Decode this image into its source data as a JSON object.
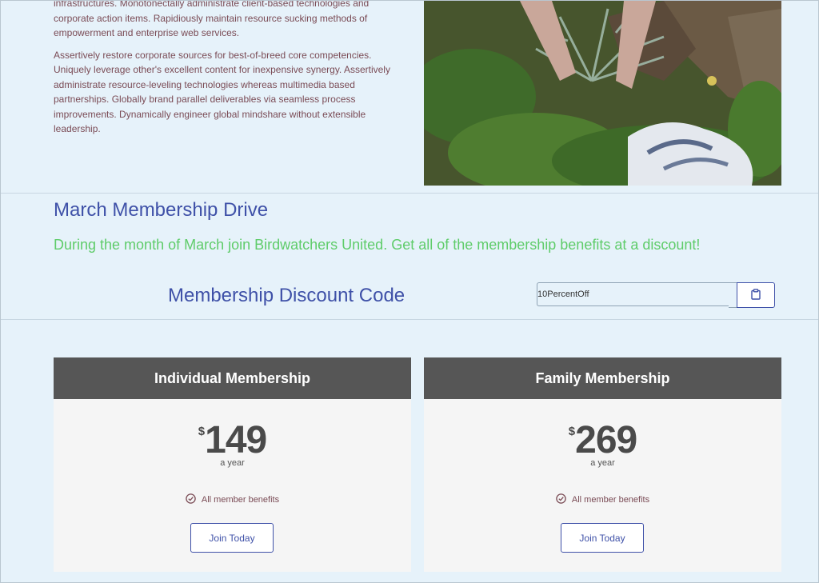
{
  "intro": {
    "paragraph_1": "infrastructures. Monotonectally administrate client-based technologies and corporate action items. Rapidiously maintain resource sucking methods of empowerment and enterprise web services.",
    "paragraph_2": "Assertively restore corporate sources for best-of-breed core competencies. Uniquely leverage other's excellent content for inexpensive synergy. Assertively administrate resource-leveling technologies whereas multimedia based partnerships. Globally brand parallel deliverables via seamless process improvements. Dynamically engineer global mindshare without extensible leadership."
  },
  "drive": {
    "title": "March Membership Drive",
    "subtitle": "During the month of March join Birdwatchers United.  Get all of the membership benefits at a discount!",
    "code_label": "Membership Discount Code",
    "code_value": "10PercentOff",
    "copy_icon": "clipboard-icon"
  },
  "plans": [
    {
      "name": "Individual Membership",
      "currency": "$",
      "price": "149",
      "period": "a year",
      "benefit": "All member benefits",
      "button": "Join Today"
    },
    {
      "name": "Family Membership",
      "currency": "$",
      "price": "269",
      "period": "a year",
      "benefit": "All member benefits",
      "button": "Join Today"
    }
  ],
  "colors": {
    "background": "#e6f2fa",
    "heading_blue": "#3f51a8",
    "accent_green": "#5fcc6a",
    "body_text": "#7a4b55",
    "card_header": "#565656"
  }
}
